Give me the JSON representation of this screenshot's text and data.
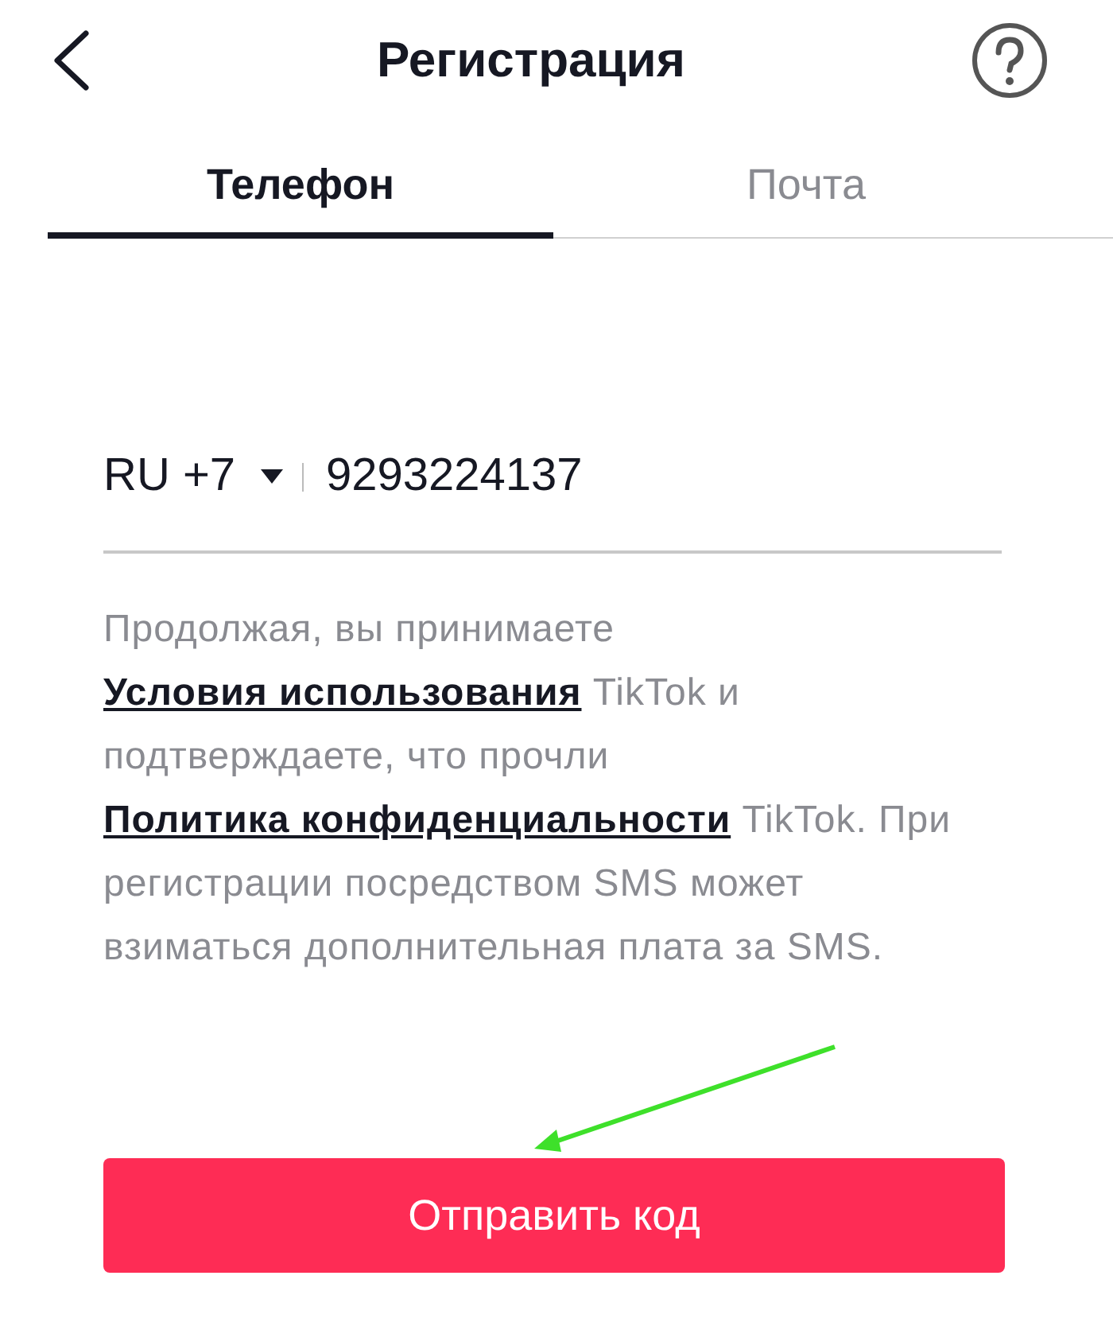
{
  "header": {
    "title": "Регистрация"
  },
  "tabs": [
    {
      "label": "Телефон",
      "selected": true
    },
    {
      "label": "Почта",
      "selected": false
    }
  ],
  "phone": {
    "country": "RU +7",
    "value": "9293224137"
  },
  "terms": [
    {
      "kind": "text",
      "text": "Продолжая, вы принимаете "
    },
    {
      "kind": "link",
      "text": "Условия использования"
    },
    {
      "kind": "text",
      "text": " TikTok и подтверждаете, что прочли "
    },
    {
      "kind": "link",
      "text": "Политика конфиденциальности"
    },
    {
      "kind": "text",
      "text": " TikTok. При регистрации посредством SMS может взиматься дополнительная плата за SMS."
    }
  ],
  "button": {
    "label": "Отправить код"
  }
}
